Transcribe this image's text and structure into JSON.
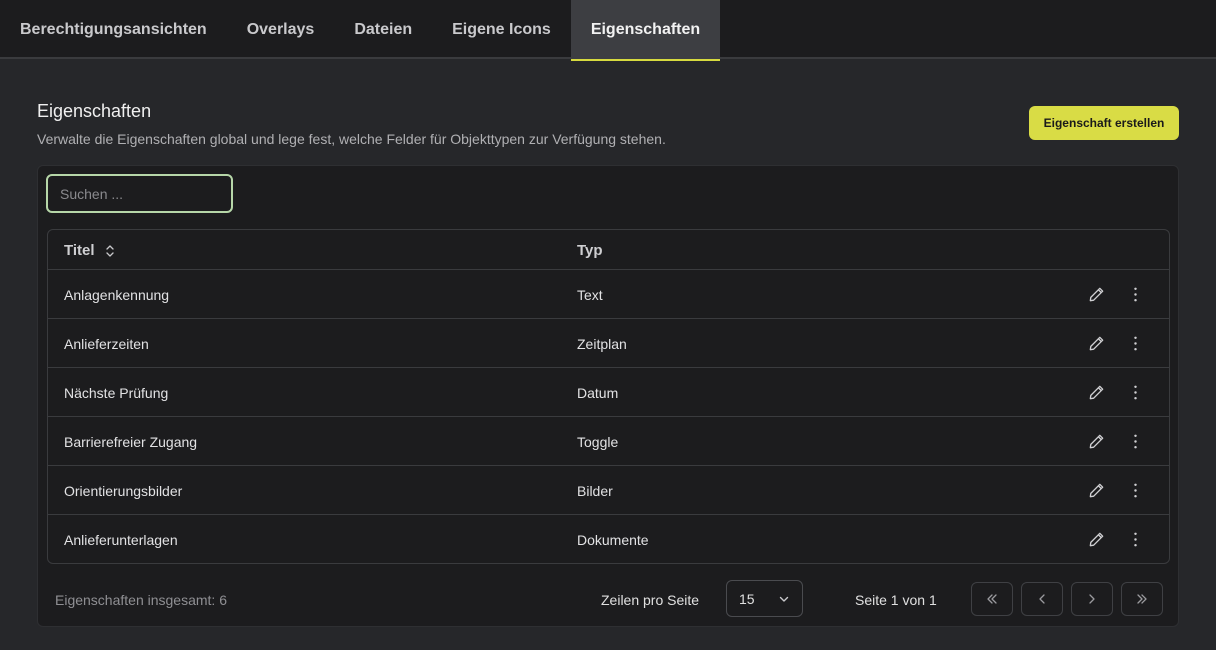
{
  "tabs": [
    {
      "label": "Berechtigungsansichten"
    },
    {
      "label": "Overlays"
    },
    {
      "label": "Dateien"
    },
    {
      "label": "Eigene Icons"
    },
    {
      "label": "Eigenschaften",
      "active": true
    }
  ],
  "header": {
    "title": "Eigenschaften",
    "subtitle": "Verwalte die Eigenschaften global und lege fest, welche Felder für Objekttypen zur Verfügung stehen.",
    "create_button": "Eigenschaft erstellen"
  },
  "search": {
    "placeholder": "Suchen ...",
    "value": ""
  },
  "table": {
    "columns": [
      "Titel",
      "Typ"
    ],
    "rows": [
      {
        "title": "Anlagenkennung",
        "type": "Text"
      },
      {
        "title": "Anlieferzeiten",
        "type": "Zeitplan"
      },
      {
        "title": "Nächste Prüfung",
        "type": "Datum"
      },
      {
        "title": "Barrierefreier Zugang",
        "type": "Toggle"
      },
      {
        "title": "Orientierungsbilder",
        "type": "Bilder"
      },
      {
        "title": "Anlieferunterlagen",
        "type": "Dokumente"
      }
    ]
  },
  "footer": {
    "total": "Eigenschaften insgesamt: 6",
    "rows_per_page_label": "Zeilen pro Seite",
    "rows_per_page_value": "15",
    "page_info": "Seite 1 von 1"
  },
  "icons": {
    "sort": "sort-icon",
    "edit": "pencil-icon",
    "more": "more-vertical-icon",
    "first": "chevrons-left-icon",
    "prev": "chevron-left-icon",
    "next": "chevron-right-icon",
    "last": "chevrons-right-icon"
  },
  "colors": {
    "accent": "#d9dc45",
    "background": "#26272a",
    "surface": "#1c1c1e"
  }
}
